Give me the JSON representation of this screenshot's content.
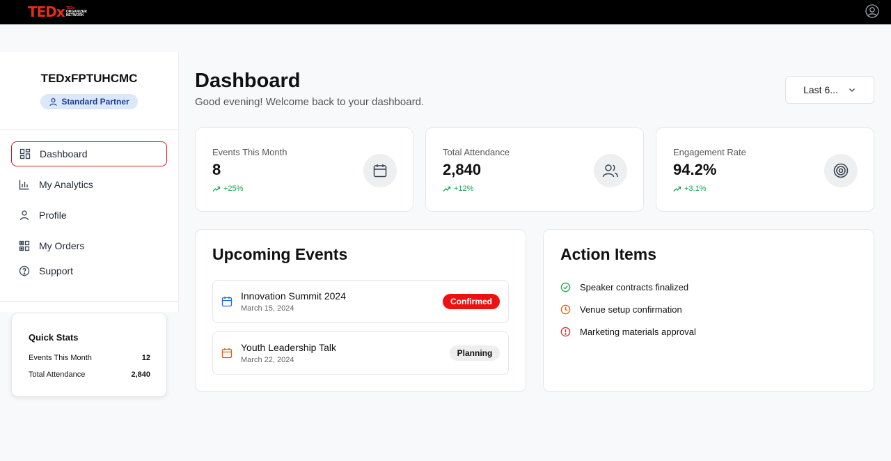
{
  "header": {
    "logo_text_a": "TED",
    "logo_text_b": "x",
    "logo_sub_1": "TEDx",
    "logo_sub_2": "ORGANIZER",
    "logo_sub_3": "NETWORK"
  },
  "sidebar": {
    "org_name": "TEDxFPTUHCMC",
    "badge": "Standard Partner",
    "items": [
      {
        "label": "Dashboard",
        "icon": "dashboard-grid-icon"
      },
      {
        "label": "My Analytics",
        "icon": "bar-chart-icon"
      },
      {
        "label": "Profile",
        "icon": "user-icon"
      },
      {
        "label": "My Orders",
        "icon": "orders-grid-icon"
      },
      {
        "label": "Support",
        "icon": "help-circle-icon"
      }
    ],
    "quick_stats": {
      "title": "Quick Stats",
      "rows": [
        {
          "label": "Events This Month",
          "value": "12"
        },
        {
          "label": "Total Attendance",
          "value": "2,840"
        }
      ]
    }
  },
  "main": {
    "title": "Dashboard",
    "subtitle": "Good evening! Welcome back to your dashboard.",
    "range_select": "Last 6...",
    "stats": [
      {
        "label": "Events This Month",
        "value": "8",
        "delta": "+25%",
        "icon": "calendar-icon"
      },
      {
        "label": "Total Attendance",
        "value": "2,840",
        "delta": "+12%",
        "icon": "users-icon"
      },
      {
        "label": "Engagement Rate",
        "value": "94.2%",
        "delta": "+3.1%",
        "icon": "target-icon"
      }
    ],
    "upcoming": {
      "title": "Upcoming Events",
      "events": [
        {
          "name": "Innovation Summit 2024",
          "date": "March 15, 2024",
          "status": "Confirmed"
        },
        {
          "name": "Youth Leadership Talk",
          "date": "March 22, 2024",
          "status": "Planning"
        }
      ]
    },
    "actions": {
      "title": "Action Items",
      "items": [
        {
          "label": "Speaker contracts finalized",
          "icon": "check-circle-icon"
        },
        {
          "label": "Venue setup confirmation",
          "icon": "clock-icon"
        },
        {
          "label": "Marketing materials approval",
          "icon": "alert-circle-icon"
        }
      ]
    }
  },
  "colors": {
    "accent_red": "#e1141f",
    "success": "#16a34a",
    "warning": "#ea580c",
    "danger": "#dc2626"
  }
}
